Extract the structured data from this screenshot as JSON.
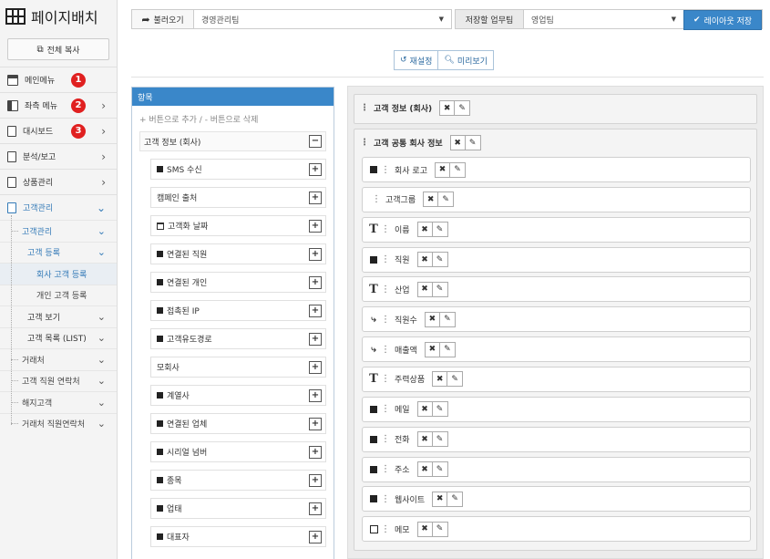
{
  "brand": {
    "title": "페이지배치"
  },
  "sidebar": {
    "copy_label": "전체 복사",
    "items": [
      {
        "label": "메인메뉴",
        "badge": "1"
      },
      {
        "label": "좌측 메뉴",
        "badge": "2"
      },
      {
        "label": "대시보드",
        "badge": "3"
      },
      {
        "label": "분석/보고"
      },
      {
        "label": "상품관리"
      },
      {
        "label": "고객관리"
      }
    ],
    "sub": {
      "customer_mgmt": "고객관리",
      "customer_register": "고객 등록",
      "company_register": "회사 고객 등록",
      "personal_register": "개인 고객 등록",
      "customer_view": "고객 보기",
      "customer_list": "고객 목록 (LIST)",
      "partners": "거래처",
      "contacts": "고객 직원 연락처",
      "hedge": "해지고객",
      "partner_contacts": "거래처 직원연락처"
    }
  },
  "topbar": {
    "load_label": "불러오기",
    "load_value": "경영관리팀",
    "save_to_label": "저장할 업무팀",
    "save_to_value": "영업팀",
    "save_button": "레이아웃 저장"
  },
  "tools": {
    "reset": "재설정",
    "preview": "미리보기"
  },
  "left_panel": {
    "header": "항목",
    "hint": "+ 버튼으로 추가 / - 버튼으로 삭제",
    "group_title": "고객 정보 (회사)",
    "fields": [
      {
        "label": "SMS 수신",
        "icon": "square"
      },
      {
        "label": "캠페인 출처",
        "icon": "none"
      },
      {
        "label": "고객화 날짜",
        "icon": "calendar"
      },
      {
        "label": "연결된 직원",
        "icon": "square"
      },
      {
        "label": "연결된 개인",
        "icon": "square"
      },
      {
        "label": "접촉된 IP",
        "icon": "square"
      },
      {
        "label": "고객유도경로",
        "icon": "square"
      },
      {
        "label": "모회사",
        "icon": "none"
      },
      {
        "label": "계열사",
        "icon": "square"
      },
      {
        "label": "연결된 업체",
        "icon": "square"
      },
      {
        "label": "시리얼 넘버",
        "icon": "square"
      },
      {
        "label": "종목",
        "icon": "square"
      },
      {
        "label": "업태",
        "icon": "square"
      },
      {
        "label": "대표자",
        "icon": "square"
      }
    ]
  },
  "right_panel": {
    "box1_title": "고객 정보 (회사)",
    "box2_title": "고객 공통 회사 정보",
    "rows": [
      {
        "label": "회사 로고",
        "type": "square"
      },
      {
        "label": "고객그룹",
        "type": "none"
      },
      {
        "label": "이름",
        "type": "text"
      },
      {
        "label": "직원",
        "type": "square"
      },
      {
        "label": "산업",
        "type": "text"
      },
      {
        "label": "직원수",
        "type": "branch"
      },
      {
        "label": "매출액",
        "type": "branch"
      },
      {
        "label": "주력상품",
        "type": "text"
      },
      {
        "label": "메일",
        "type": "square"
      },
      {
        "label": "전화",
        "type": "square"
      },
      {
        "label": "주소",
        "type": "square"
      },
      {
        "label": "웹사이트",
        "type": "square"
      },
      {
        "label": "메모",
        "type": "outline"
      }
    ]
  }
}
